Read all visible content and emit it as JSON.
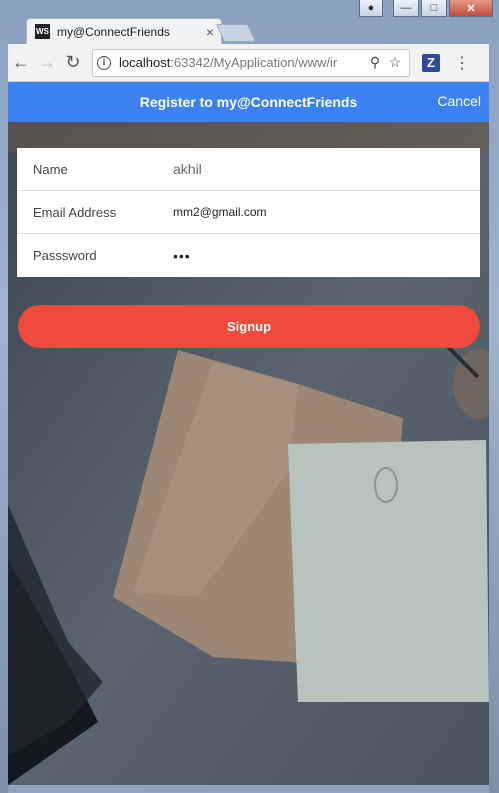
{
  "browser": {
    "tab_title": "my@ConnectFriends",
    "favicon_text": "WS",
    "tab_close": "×",
    "url_host": "localhost",
    "url_rest": ":63342/MyApplication/www/ir",
    "ext_letter": "Z",
    "colors": {
      "chrome": "#f2f2f2"
    }
  },
  "header": {
    "title": "Register to my@ConnectFriends",
    "cancel_label": "Cancel",
    "color": "#3b82f0"
  },
  "form": {
    "name_label": "Name",
    "name_value": "akhil",
    "email_label": "Email Address",
    "email_value": "mm2@gmail.com",
    "password_label": "Passsword",
    "password_mask": "•••"
  },
  "signup": {
    "label": "Signup",
    "color": "#ef4a3c"
  },
  "icons": [
    "back-icon",
    "forward-icon",
    "reload-icon",
    "info-icon",
    "zoom-icon",
    "star-icon",
    "extension-icon",
    "menu-icon",
    "user-icon",
    "minimize-icon",
    "maximize-icon",
    "close-icon"
  ]
}
